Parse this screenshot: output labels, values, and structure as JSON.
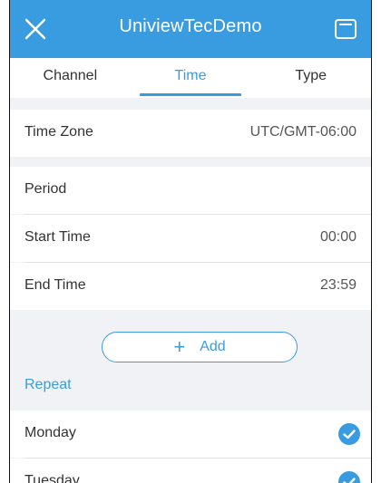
{
  "app_bar": {
    "title": "UniviewTecDemo",
    "close_icon": "close-icon",
    "save_icon": "save-icon",
    "accent_color": "#3a9ce0"
  },
  "tabs": [
    {
      "label": "Channel",
      "active": false
    },
    {
      "label": "Time",
      "active": true
    },
    {
      "label": "Type",
      "active": false
    }
  ],
  "time_zone": {
    "label": "Time Zone",
    "value": "UTC/GMT-06:00"
  },
  "period": {
    "label": "Period",
    "start": {
      "label": "Start Time",
      "value": "00:00"
    },
    "end": {
      "label": "End Time",
      "value": "23:59"
    }
  },
  "add_button": {
    "label": "Add",
    "icon": "plus-icon"
  },
  "repeat": {
    "label": "Repeat",
    "days": [
      {
        "label": "Monday",
        "checked": true
      },
      {
        "label": "Tuesday",
        "checked": true
      }
    ]
  }
}
